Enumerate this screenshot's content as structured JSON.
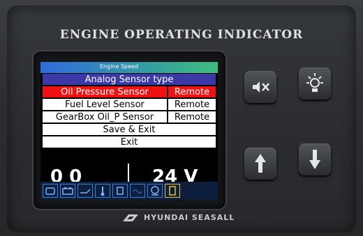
{
  "device": {
    "title": "ENGINE OPERATING INDICATOR",
    "brand": "HYUNDAI SEASALL"
  },
  "screen": {
    "top_bar_label": "Engine Speed",
    "menu": {
      "header": "Analog Sensor type",
      "items": [
        {
          "label": "Oil Pressure Sensor",
          "value": "Remote",
          "selected": true
        },
        {
          "label": "Fuel Level Sensor",
          "value": "Remote",
          "selected": false
        },
        {
          "label": "GearBox Oil_P Sensor",
          "value": "Remote",
          "selected": false
        }
      ],
      "save_exit": "Save & Exit",
      "exit": "Exit"
    },
    "readout_left": "0 0",
    "readout_right": "24 V",
    "status_icons": [
      "engine-icon",
      "battery-icon",
      "oil-lamp-icon",
      "temperature-icon",
      "fuel-icon",
      "glow-plug-icon",
      "warning-icon",
      "lock-icon"
    ]
  },
  "buttons": {
    "mute": "mute-icon",
    "lamp_test": "lamp-icon",
    "up": "arrow-up-icon",
    "down": "arrow-down-icon"
  },
  "colors": {
    "menu_header": "#3a39a6",
    "selected_row": "#f01212",
    "row_bg": "#ffffff"
  }
}
